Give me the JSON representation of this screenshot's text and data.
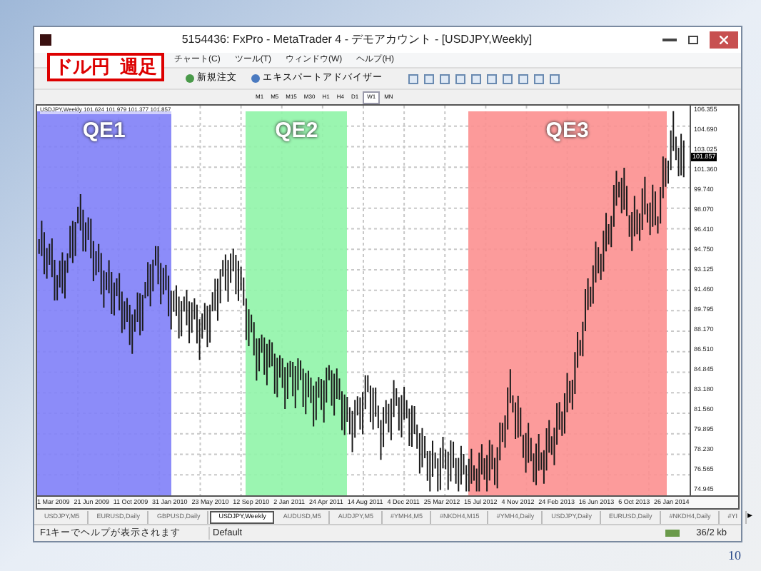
{
  "window": {
    "title": "5154436: FxPro - MetaTrader 4 - デモアカウント - [USDJPY,Weekly]"
  },
  "menu": [
    "チャート(C)",
    "ツール(T)",
    "ウィンドウ(W)",
    "ヘルプ(H)"
  ],
  "overlay_label": "ドル円  週足",
  "toolbar": {
    "buttons": [
      "新規注文",
      "エキスパートアドバイザー"
    ]
  },
  "timeframes": [
    {
      "label": "M1",
      "selected": false
    },
    {
      "label": "M5",
      "selected": false
    },
    {
      "label": "M15",
      "selected": false
    },
    {
      "label": "M30",
      "selected": false
    },
    {
      "label": "H1",
      "selected": false
    },
    {
      "label": "H4",
      "selected": false
    },
    {
      "label": "D1",
      "selected": false
    },
    {
      "label": "W1",
      "selected": true
    },
    {
      "label": "MN",
      "selected": false
    }
  ],
  "chart": {
    "header": "USDJPY,Weekly  101.624 101.979 101.377 101.857",
    "current_price": "101.857",
    "bands": [
      {
        "label": "QE1",
        "color": "#8080f8"
      },
      {
        "label": "QE2",
        "color": "#90f4a8"
      },
      {
        "label": "QE3",
        "color": "#fc9090"
      }
    ],
    "y_labels": [
      "106.355",
      "104.690",
      "103.025",
      "101.360",
      "99.740",
      "98.070",
      "96.410",
      "94.750",
      "93.125",
      "91.460",
      "89.795",
      "88.170",
      "86.510",
      "84.845",
      "83.180",
      "81.560",
      "79.895",
      "78.230",
      "76.565",
      "74.945"
    ],
    "x_labels": [
      "1 Mar 2009",
      "21 Jun 2009",
      "11 Oct 2009",
      "31 Jan 2010",
      "23 May 2010",
      "12 Sep 2010",
      "2 Jan 2011",
      "24 Apr 2011",
      "14 Aug 2011",
      "4 Dec 2011",
      "25 Mar 2012",
      "15 Jul 2012",
      "4 Nov 2012",
      "24 Feb 2013",
      "16 Jun 2013",
      "6 Oct 2013",
      "26 Jan 2014"
    ]
  },
  "tabs": [
    {
      "label": "USDJPY,M5",
      "selected": false
    },
    {
      "label": "EURUSD,Daily",
      "selected": false
    },
    {
      "label": "GBPUSD,Daily",
      "selected": false
    },
    {
      "label": "USDJPY,Weekly",
      "selected": true
    },
    {
      "label": "AUDUSD,M5",
      "selected": false
    },
    {
      "label": "AUDJPY,M5",
      "selected": false
    },
    {
      "label": "#YMH4,M5",
      "selected": false
    },
    {
      "label": "#NKDH4,M15",
      "selected": false
    },
    {
      "label": "#YMH4,Daily",
      "selected": false
    },
    {
      "label": "USDJPY,Daily",
      "selected": false
    },
    {
      "label": "EURUSD,Daily",
      "selected": false
    },
    {
      "label": "#NKDH4,Daily",
      "selected": false
    },
    {
      "label": "#YI",
      "selected": false
    }
  ],
  "tab_scroll": "▸",
  "status_bar": {
    "help": "F1キーでヘルプが表示されます",
    "profile": "Default",
    "traffic": "36/2 kb"
  },
  "page_number": "10"
}
